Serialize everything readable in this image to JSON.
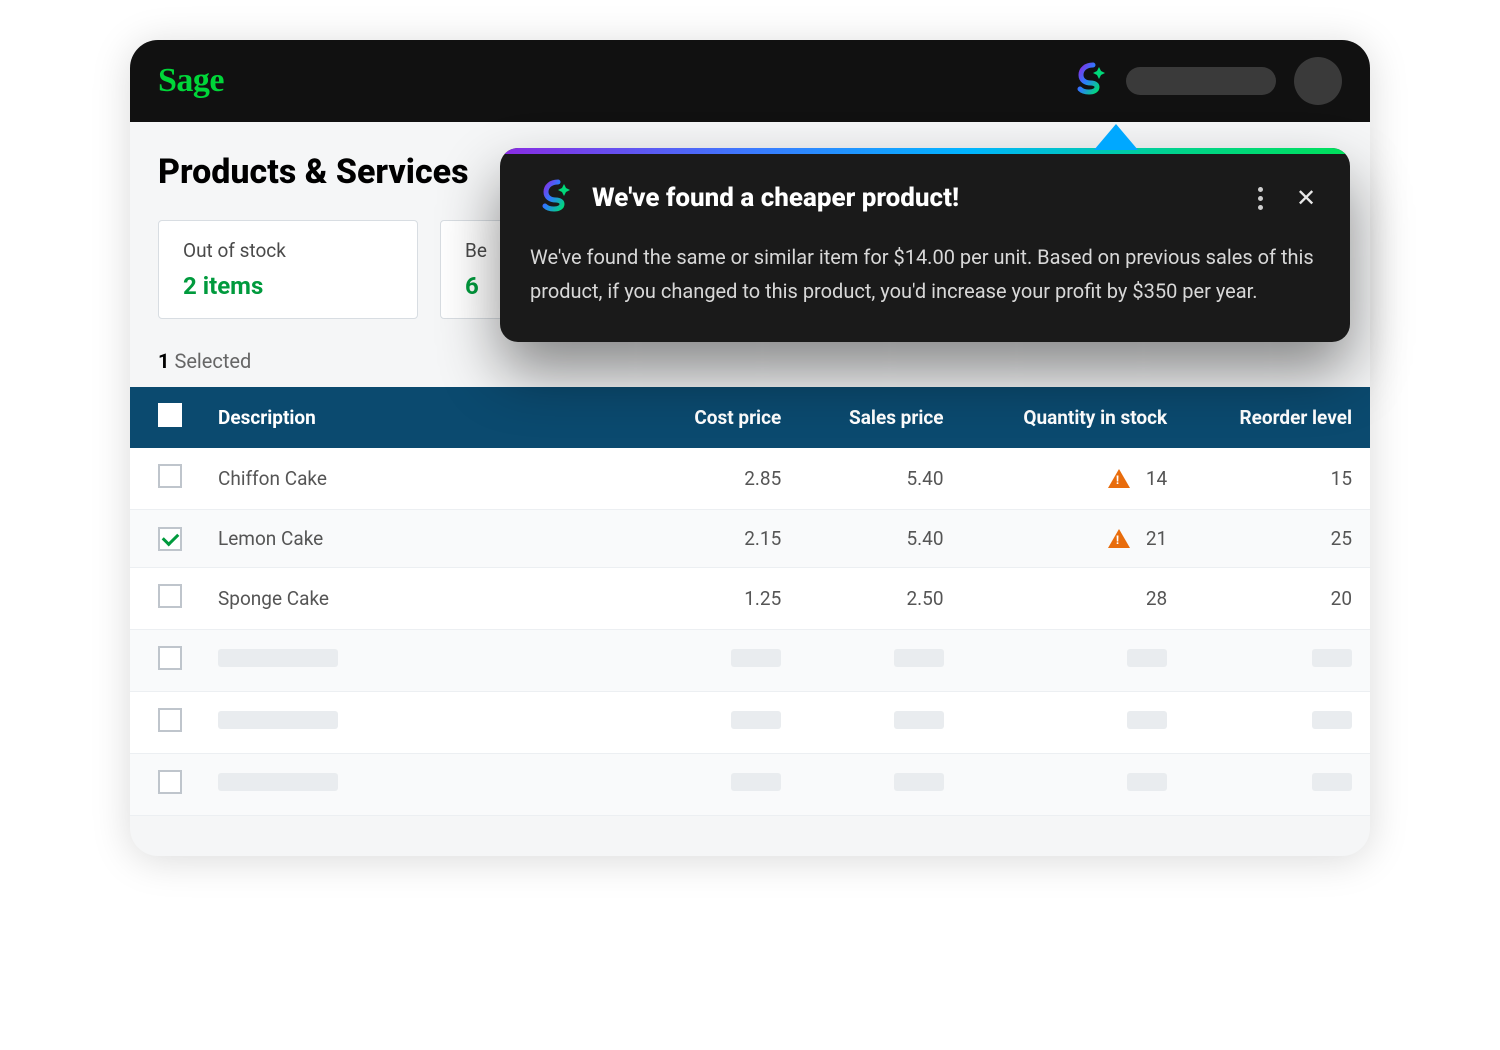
{
  "brand": {
    "name": "Sage"
  },
  "page": {
    "title": "Products & Services",
    "selected_count": "1",
    "selected_label": "Selected"
  },
  "cards": [
    {
      "label": "Out of stock",
      "value": "2 items"
    },
    {
      "label": "Be",
      "value": "6 "
    }
  ],
  "table": {
    "headers": {
      "description": "Description",
      "cost_price": "Cost price",
      "sales_price": "Sales price",
      "qty": "Quantity in stock",
      "reorder": "Reorder  level"
    },
    "rows": [
      {
        "checked": false,
        "desc": "Chiffon Cake",
        "cost": "2.85",
        "sales": "5.40",
        "warn": true,
        "qty": "14",
        "reorder": "15"
      },
      {
        "checked": true,
        "desc": "Lemon Cake",
        "cost": "2.15",
        "sales": "5.40",
        "warn": true,
        "qty": "21",
        "reorder": "25"
      },
      {
        "checked": false,
        "desc": "Sponge Cake",
        "cost": "1.25",
        "sales": "2.50",
        "warn": false,
        "qty": "28",
        "reorder": "20"
      }
    ]
  },
  "popover": {
    "title": "We've found a cheaper product!",
    "body": "We've found the same or similar item for $14.00 per unit. Based on previous sales of this product, if you changed to this product, you'd increase your profit by $350 per year."
  }
}
